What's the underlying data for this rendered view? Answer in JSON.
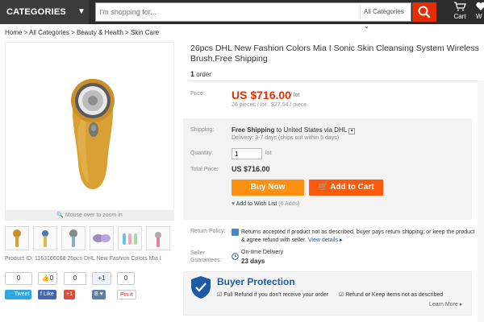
{
  "header": {
    "categories_label": "CATEGORIES",
    "search_placeholder": "I'm shopping for...",
    "search_category": "All Categories",
    "cart_label": "Cart",
    "wish_label": "W"
  },
  "breadcrumb": {
    "items": [
      "Home",
      "All Categories",
      "Beauty & Health",
      "Skin Care"
    ],
    "separator": ">"
  },
  "gallery": {
    "zoom_hint": "Mouse over to zoom in",
    "product_id_line": "Product ID: 1163166088 26pcs DHL New Fashion Colors Mia I"
  },
  "social": {
    "tweet_count": "0",
    "like_count": "0",
    "plusone_count": "0",
    "plus_label": "+1",
    "vk_count": "0",
    "tweet_label": "Tweet",
    "like_label": "Like",
    "gplus_label": "+1",
    "vk_label": "B",
    "pin_label": "Pin it"
  },
  "product": {
    "title_line1": "26pcs DHL New Fashion Colors Mia I Sonic Skin Cleansing System Wireless",
    "title_line2": "Brush,Free Shipping",
    "order_count": "1",
    "order_label": "order",
    "price_label": "Price:",
    "price": "US $716.00",
    "price_unit": "/ lot",
    "price_sub": "26 pieces / lot , $27.54 / piece",
    "shipping_label": "Shipping:",
    "shipping_free": "Free Shipping",
    "shipping_to": "to United States via DHL",
    "delivery": "Delivery: 3-7 days (ships out within 5 days)",
    "quantity_label": "Quantity:",
    "quantity_value": "1",
    "quantity_unit": "lot",
    "total_label": "Total Price:",
    "total_price": "US $716.00",
    "buy_now": "Buy Now",
    "add_to_cart": "Add to Cart",
    "wishlist": "Add to Wish List",
    "wishlist_count": "(6 Adds)",
    "return_label": "Return Policy:",
    "return_text": "Returns accepted if product not as described, buyer pays return shipping; or keep the product & agree refund with seller.",
    "view_details": "View details",
    "guarantee_label": "Seller Guarantees:",
    "guarantee_title": "On-time Delivery",
    "guarantee_days": "23 days"
  },
  "protection": {
    "title": "Buyer Protection",
    "item1": "Full Refund if you don't receive your order",
    "item2": "Refund or Keep items not as described",
    "learn_more": "Learn More"
  },
  "colors": {
    "accent": "#e62e04",
    "buy": "#ff9112",
    "cart": "#ff5a0c",
    "protection": "#1f5aa6"
  }
}
